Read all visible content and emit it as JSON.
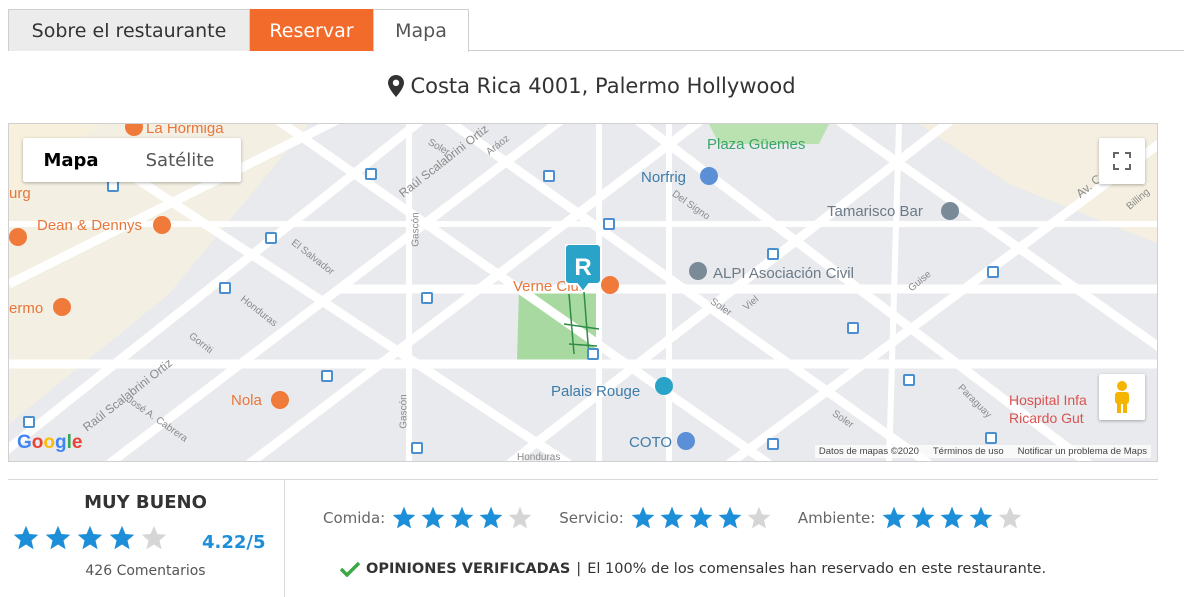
{
  "tabs": {
    "about": "Sobre el restaurante",
    "reserve": "Reservar",
    "map": "Mapa"
  },
  "address": "Costa Rica 4001, Palermo Hollywood",
  "map": {
    "type_map": "Mapa",
    "type_satellite": "Satélite",
    "google": "Google",
    "attribution": {
      "data": "Datos de mapas ©2020",
      "terms": "Términos de uso",
      "report": "Notificar un problema de Maps"
    },
    "pois": {
      "plaza": "Plaza Güemes",
      "norfrig": "Norfrig",
      "tamarisco": "Tamarisco Bar",
      "alpi": "ALPI Asociación Civil",
      "verne": "Verne Club",
      "dean": "Dean & Dennys",
      "nola": "Nola",
      "palais": "Palais Rouge",
      "coto": "COTO",
      "hospital1": "Hospital Infa",
      "hospital2": "Ricardo Gut",
      "hormiga": "La Hormiga",
      "urg": "urg",
      "ermo": "ermo"
    },
    "streets": {
      "raul1": "Raúl Scalabrini Ortiz",
      "raul2": "Raúl Scalabrini Ortiz",
      "soler1": "Soler",
      "soler2": "Soler",
      "soler3": "Soler",
      "aroz": "Aráoz",
      "gorriti": "Gorriti",
      "honduras1": "Honduras",
      "honduras2": "Honduras",
      "salvador": "El Salvador",
      "gascon1": "Gascón",
      "gascon2": "Gascón",
      "josecabrera": "José A. Cabrera",
      "delsigno": "Del Signo",
      "viel": "Viel",
      "guise": "Guise",
      "paraguay": "Paraguay",
      "avdiaz": "Av. Cnel. Díaz",
      "billing": "Billing"
    },
    "accent_orange": "#f26b2b",
    "marker_color": "#2aa3c9"
  },
  "rating": {
    "verdict": "MUY BUENO",
    "score": "4.22/5",
    "overall_stars": 4,
    "comments": "426 Comentarios",
    "star_color": "#1d8ed8",
    "subratings": [
      {
        "label": "Comida:",
        "stars": 4
      },
      {
        "label": "Servicio:",
        "stars": 4
      },
      {
        "label": "Ambiente:",
        "stars": 4
      }
    ],
    "verified_strong": "OPINIONES VERIFICADAS",
    "verified_sep": "|",
    "verified_text": "El 100% de los comensales han reservado en este restaurante."
  }
}
